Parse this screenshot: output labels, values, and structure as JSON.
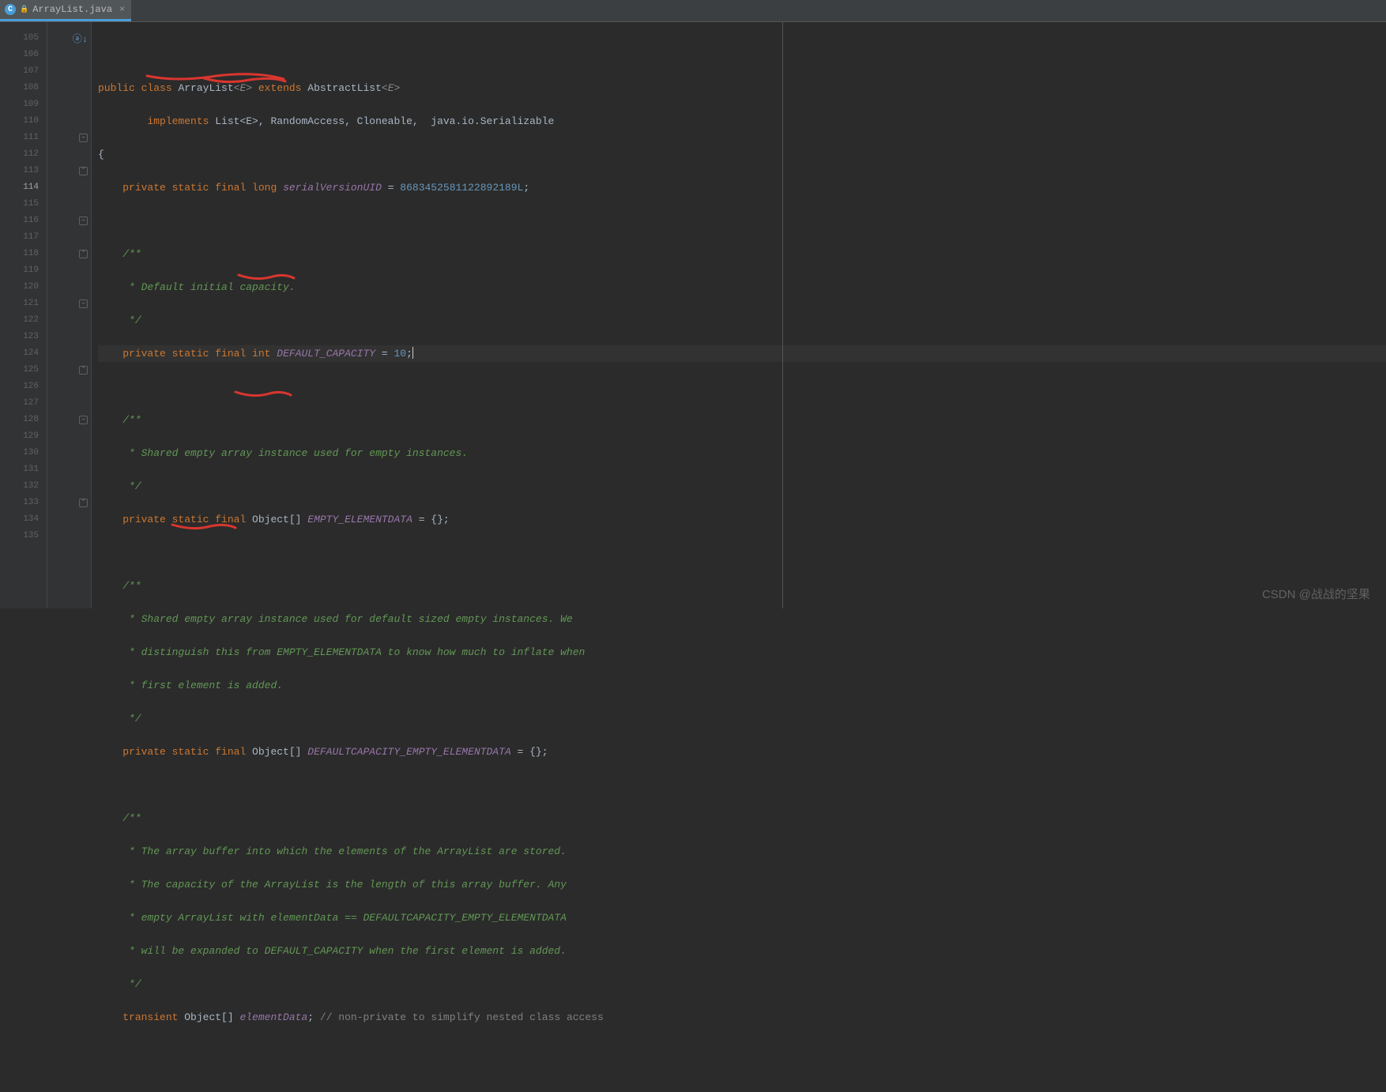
{
  "tab": {
    "filename": "ArrayList.java",
    "icon_letter": "C"
  },
  "gutter": {
    "active_line": 114,
    "lines": [
      105,
      106,
      107,
      108,
      109,
      110,
      111,
      112,
      113,
      114,
      115,
      116,
      117,
      118,
      119,
      120,
      121,
      122,
      123,
      124,
      125,
      126,
      127,
      128,
      129,
      130,
      131,
      132,
      133,
      134,
      135
    ]
  },
  "fold": {
    "icons": {
      "105": "av",
      "111": "open",
      "113": "close",
      "116": "open",
      "118": "close",
      "121": "open",
      "125": "close",
      "128": "open",
      "133": "close"
    }
  },
  "code": {
    "l105": "",
    "l106_kw1": "public",
    "l106_kw2": "class",
    "l106_name": " ArrayList",
    "l106_gen": "<E>",
    "l106_kw3": " extends",
    "l106_abs": " AbstractList",
    "l106_gen2": "<E>",
    "l107_kw": "implements",
    "l107_rest": " List<E>, RandomAccess, Cloneable,  java.io.Serializable",
    "l108": "{",
    "l109_pre": "private static final long ",
    "l109_var": "serialVersionUID",
    "l109_eq": " = ",
    "l109_num": "8683452581122892189L",
    "l109_end": ";",
    "l111": "/**",
    "l112": " * Default initial capacity.",
    "l113": " */",
    "l114_pre": "private static final int ",
    "l114_var": "DEFAULT_CAPACITY",
    "l114_eq": " = ",
    "l114_num": "10",
    "l114_end": ";",
    "l116": "/**",
    "l117": " * Shared empty array instance used for empty instances.",
    "l118": " */",
    "l119_pre": "private static final ",
    "l119_obj": "Object[] ",
    "l119_var": "EMPTY_ELEMENTDATA",
    "l119_end": " = {};",
    "l121": "/**",
    "l122": " * Shared empty array instance used for default sized empty instances. We",
    "l123": " * distinguish this from EMPTY_ELEMENTDATA to know how much to inflate when",
    "l124": " * first element is added.",
    "l125": " */",
    "l126_pre": "private static final ",
    "l126_obj": "Object[] ",
    "l126_var": "DEFAULTCAPACITY_EMPTY_ELEMENTDATA",
    "l126_end": " = {};",
    "l128": "/**",
    "l129": " * The array buffer into which the elements of the ArrayList are stored.",
    "l130": " * The capacity of the ArrayList is the length of this array buffer. Any",
    "l131": " * empty ArrayList with elementData == DEFAULTCAPACITY_EMPTY_ELEMENTDATA",
    "l132": " * will be expanded to DEFAULT_CAPACITY when the first element is added.",
    "l133": " */",
    "l134_kw": "transient ",
    "l134_obj": "Object[] ",
    "l134_var": "elementData",
    "l134_sc": ";",
    "l134_cmt": " // non-private to simplify nested class access"
  },
  "watermark": "CSDN @战战的坚果"
}
